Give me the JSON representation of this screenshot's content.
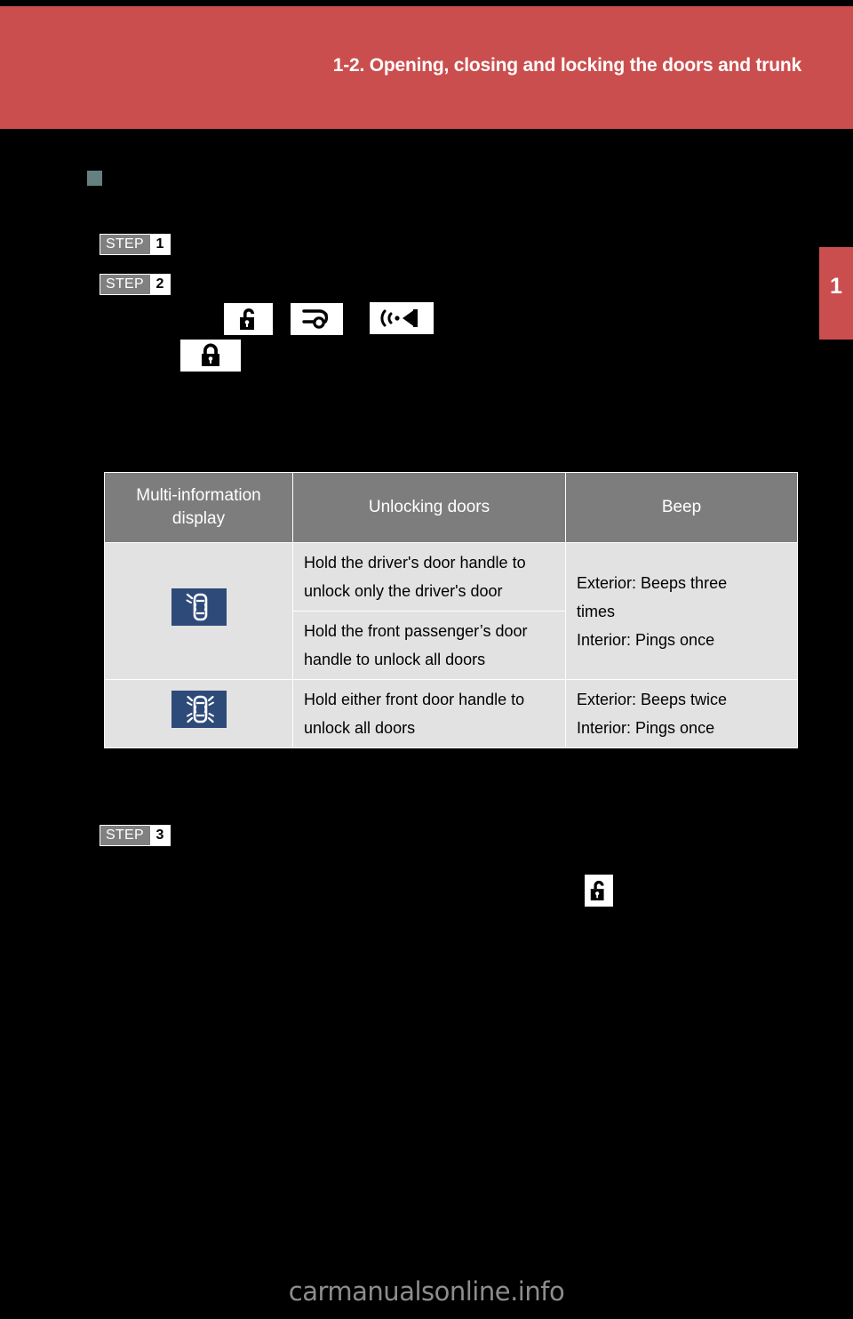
{
  "page": {
    "background_color": "#000000",
    "accent_color": "#cb4e4e",
    "bullet_color": "#65807f",
    "table_header_color": "#7d7d7d",
    "table_body_color": "#e2e2e2",
    "mid_tile_color": "#2e4a79"
  },
  "header": {
    "title": "1-2. Opening, closing and locking the doors and trunk"
  },
  "chapter_tab": {
    "number": "1"
  },
  "steps": [
    {
      "word": "STEP",
      "number": "1"
    },
    {
      "word": "STEP",
      "number": "2"
    },
    {
      "word": "STEP",
      "number": "3"
    }
  ],
  "icons": {
    "unlock_1": "unlock-padlock-icon",
    "trunk": "trunk-open-key-icon",
    "beep": "speaker-beep-icon",
    "lock_1": "locked-padlock-icon",
    "unlock_2": "unlock-padlock-icon"
  },
  "table": {
    "headers": [
      "Multi-information display",
      "Unlocking doors",
      "Beep"
    ],
    "rows": [
      {
        "mid_icon": "car-driver-door-unlock-icon",
        "unlocking": [
          "Hold the driver's door handle to unlock only the driver's door",
          "Hold the front passenger’s door handle to unlock all doors"
        ],
        "beep": "Exterior: Beeps three times\nInterior: Pings once",
        "beep_lines": [
          "Exterior: Beeps three",
          "times",
          "Interior: Pings once"
        ]
      },
      {
        "mid_icon": "car-all-doors-unlock-icon",
        "unlocking": [
          "Hold either front door handle to unlock all doors"
        ],
        "beep": "Exterior: Beeps twice\nInterior: Pings once",
        "beep_lines": [
          "Exterior: Beeps twice",
          "Interior: Pings once"
        ]
      }
    ]
  },
  "footer": {
    "watermark": "carmanualsonline.info"
  }
}
